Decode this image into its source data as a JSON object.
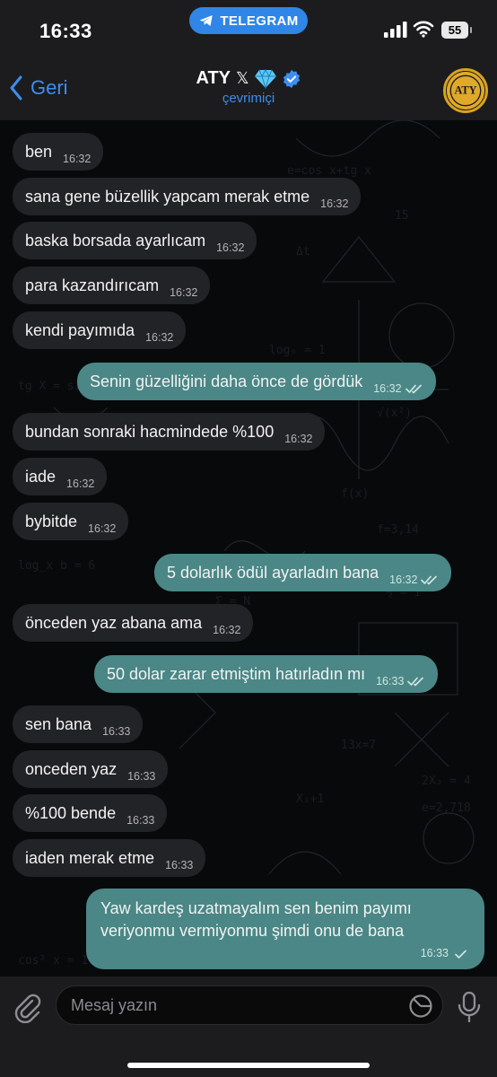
{
  "status_bar": {
    "time": "16:33",
    "app_pill": "TELEGRAM",
    "battery": "55"
  },
  "header": {
    "back_label": "Geri",
    "title": "ATY",
    "x_mark": "𝕏",
    "subtitle": "çevrimiçi",
    "avatar_text": "ATY"
  },
  "messages": [
    {
      "dir": "in",
      "text": "ben",
      "time": "16:32"
    },
    {
      "dir": "in",
      "text": "sana gene büzellik yapcam merak etme",
      "time": "16:32"
    },
    {
      "dir": "in",
      "text": "baska borsada ayarlıcam",
      "time": "16:32"
    },
    {
      "dir": "in",
      "text": "para kazandırıcam",
      "time": "16:32"
    },
    {
      "dir": "in",
      "text": "kendi payımıda",
      "time": "16:32"
    },
    {
      "dir": "out",
      "text": "Senin güzelliğini daha önce de gördük",
      "time": "16:32",
      "status": "read"
    },
    {
      "dir": "in",
      "text": "bundan sonraki hacmindede %100",
      "time": "16:32"
    },
    {
      "dir": "in",
      "text": "iade",
      "time": "16:32"
    },
    {
      "dir": "in",
      "text": "bybitde",
      "time": "16:32"
    },
    {
      "dir": "out",
      "text": "5 dolarlık ödül ayarladın bana",
      "time": "16:32",
      "status": "read"
    },
    {
      "dir": "in",
      "text": "önceden yaz abana ama",
      "time": "16:32"
    },
    {
      "dir": "out",
      "text": "50 dolar zarar etmiştim hatırladın mı",
      "time": "16:33",
      "status": "read"
    },
    {
      "dir": "in",
      "text": "sen bana",
      "time": "16:33"
    },
    {
      "dir": "in",
      "text": "onceden yaz",
      "time": "16:33"
    },
    {
      "dir": "in",
      "text": "%100 bende",
      "time": "16:33"
    },
    {
      "dir": "in",
      "text": "iaden merak etme",
      "time": "16:33"
    },
    {
      "dir": "out",
      "text_lines": [
        "Yaw kardeş uzatmayalım sen benim payımı",
        "veriyonmu vermiyonmu şimdi onu de bana"
      ],
      "time": "16:33",
      "status": "sent"
    }
  ],
  "input": {
    "placeholder": "Mesaj yazın"
  },
  "colors": {
    "accent": "#3d8ef0",
    "outgoing_bubble": "#4a8786",
    "incoming_bubble": "#222326",
    "telegram_pill": "#2f86e6",
    "verified": "#3d8ef0"
  },
  "icons": {
    "attach": "paperclip-icon",
    "sticker": "sticker-icon",
    "mic": "microphone-icon",
    "back": "chevron-left-icon",
    "verified": "verified-badge-icon",
    "gem": "diamond-icon"
  }
}
